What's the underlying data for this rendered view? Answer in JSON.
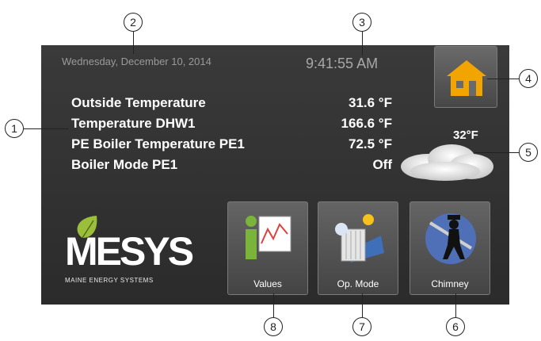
{
  "header": {
    "date": "Wednesday, December 10, 2014",
    "time": "9:41:55 AM"
  },
  "readings": [
    {
      "label": "Outside Temperature",
      "value": "31.6 °F"
    },
    {
      "label": "Temperature DHW1",
      "value": "166.6 °F"
    },
    {
      "label": "PE Boiler Temperature PE1",
      "value": "72.5 °F"
    },
    {
      "label": "Boiler Mode PE1",
      "value": "Off"
    }
  ],
  "weather": {
    "temperature": "32°F",
    "icon": "cloud-icon"
  },
  "home": {
    "icon": "home-icon",
    "color": "#f2a500"
  },
  "logo": {
    "main": "MESYS",
    "sub": "MAINE ENERGY SYSTEMS"
  },
  "tiles": [
    {
      "label": "Values",
      "icon": "values-chart-icon"
    },
    {
      "label": "Op. Mode",
      "icon": "op-mode-icon"
    },
    {
      "label": "Chimney",
      "icon": "chimney-sweep-icon"
    }
  ],
  "callouts": [
    "1",
    "2",
    "3",
    "4",
    "5",
    "6",
    "7",
    "8"
  ]
}
